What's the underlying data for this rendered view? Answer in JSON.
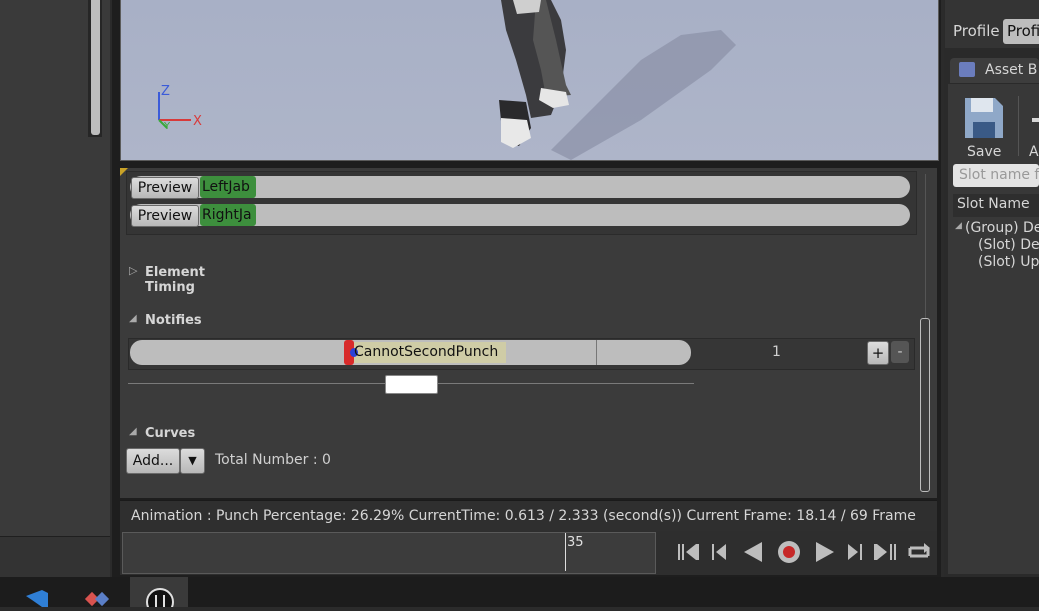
{
  "viewport": {
    "axis_z": "Z",
    "axis_x": "X",
    "axis_y": "Y"
  },
  "slots": [
    {
      "button": "Preview",
      "section": "LeftJab"
    },
    {
      "button": "Preview",
      "section": "RightJa"
    }
  ],
  "sections": {
    "element_timing": "Element Timing",
    "notifies": "Notifies",
    "curves": "Curves"
  },
  "notify": {
    "name": "CannotSecondPunch",
    "track_number": "1",
    "add": "+",
    "remove": "-"
  },
  "curves": {
    "add_button": "Add...",
    "total": "Total Number : 0"
  },
  "status": {
    "text": "Animation :  Punch  Percentage:  26.29%  CurrentTime:  0.613 / 2.333  (second(s))  Current Frame:  18.14 / 69 Frame"
  },
  "scrubber": {
    "frame": "35"
  },
  "transport_icons": [
    "skip-to-start-icon",
    "step-back-icon",
    "play-reverse-icon",
    "record-icon",
    "play-icon",
    "step-forward-icon",
    "skip-to-end-icon",
    "loop-icon"
  ],
  "right_panel": {
    "profile_label": "Profile",
    "profile_value": "Profi",
    "asset_tab": "Asset B",
    "save": "Save",
    "add_short": "A",
    "search_placeholder": "Slot name f",
    "column": "Slot Name",
    "tree": [
      "(Group) De",
      "(Slot) Def",
      "(Slot) Up"
    ]
  }
}
